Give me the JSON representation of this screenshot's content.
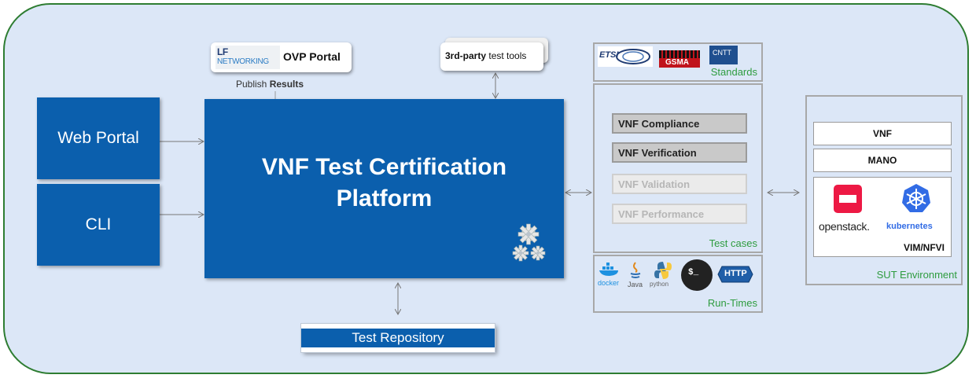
{
  "left": {
    "web_portal": "Web Portal",
    "cli": "CLI"
  },
  "platform": {
    "line1": "VNF Test Certification",
    "line2": "Platform"
  },
  "repository": "Test Repository",
  "ovp": {
    "lf_logo": "LF",
    "networking": "NETWORKING",
    "portal": "OVP Portal",
    "publish_prefix": "Publish",
    "publish_bold": "Results"
  },
  "tools": {
    "bold": "3rd-party",
    "rest": "test tools"
  },
  "standards": {
    "label": "Standards",
    "logos": [
      "ETSI",
      "GSMA",
      "CNTT"
    ]
  },
  "test_cases": {
    "label": "Test cases",
    "items": [
      "VNF Compliance",
      "VNF Verification",
      "VNF Validation",
      "VNF Performance"
    ]
  },
  "runtimes": {
    "label": "Run-Times",
    "logos": [
      "docker",
      "Java",
      "python",
      "$_",
      "HTTP"
    ]
  },
  "sut": {
    "vnf": "VNF",
    "mano": "MANO",
    "openstack": "openstack.",
    "kubernetes": "kubernetes",
    "vim": "VIM/NFVI",
    "label": "SUT Environment"
  }
}
